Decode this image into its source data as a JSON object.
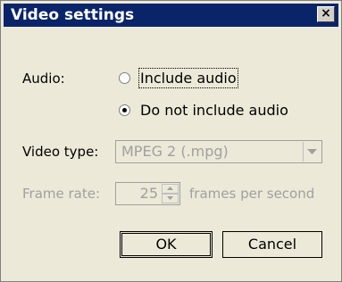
{
  "window": {
    "title": "Video settings",
    "close_glyph": "×"
  },
  "audio": {
    "label": "Audio:",
    "options": [
      {
        "label": "Include audio",
        "checked": false
      },
      {
        "label": "Do not include audio",
        "checked": true
      }
    ]
  },
  "video_type": {
    "label": "Video type:",
    "value": "MPEG 2 (.mpg)"
  },
  "frame_rate": {
    "label": "Frame rate:",
    "value": "25",
    "units": "frames per second"
  },
  "buttons": {
    "ok": "OK",
    "cancel": "Cancel"
  },
  "colors": {
    "titlebar": "#0a246a",
    "disabled_text": "#a0a0a0",
    "dialog_bg": "#ece9d8"
  }
}
